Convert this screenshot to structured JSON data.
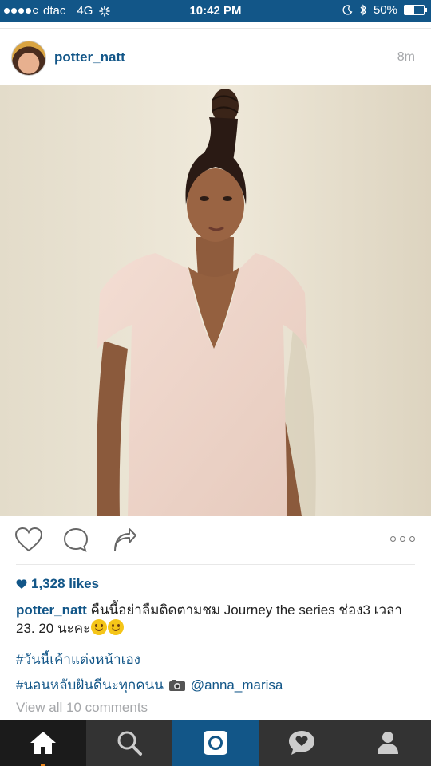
{
  "status_bar": {
    "carrier": "dtac",
    "network": "4G",
    "time": "10:42 PM",
    "battery": "50%",
    "battery_level": 0.5
  },
  "post": {
    "username": "potter_natt",
    "time_ago": "8m",
    "likes": "1,328 likes",
    "caption_user": "potter_natt",
    "caption_text": " คืนนี้อย่าลืมติดตามชม Journey the series  ช่อง3 เวลา 23. 20 นะคะ",
    "hashtag_1": "#วันนี้เค้าแต่งหน้าเอง",
    "hashtag_2": "#นอนหลับฝันดีนะทุกคนน",
    "mention": "@anna_marisa",
    "view_comments": "View all 10 comments"
  },
  "colors": {
    "brand_blue": "#125688",
    "tab_bar": "#333333",
    "muted": "#a5a7aa",
    "active_tab_mark": "#e8831a"
  },
  "icons": {
    "status": [
      "signal-dots-icon",
      "activity-spinner-icon",
      "moon-icon",
      "bluetooth-icon",
      "battery-icon"
    ],
    "actions": [
      "heart-icon",
      "comment-icon",
      "share-icon",
      "more-options-icon"
    ],
    "tabs": [
      "home-icon",
      "search-icon",
      "camera-icon",
      "activity-icon",
      "profile-icon"
    ]
  }
}
